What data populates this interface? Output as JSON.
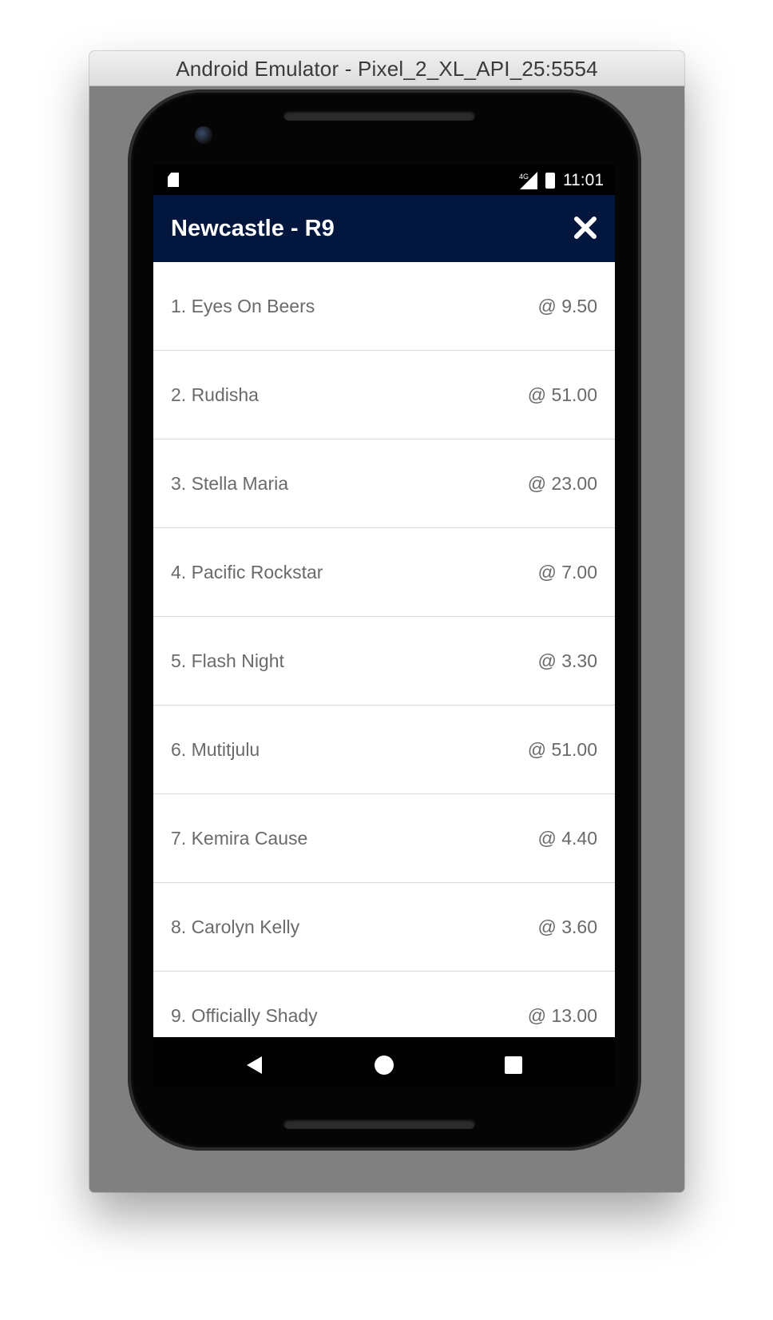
{
  "window": {
    "title": "Android Emulator - Pixel_2_XL_API_25:5554"
  },
  "statusbar": {
    "network": "4G",
    "time": "11:01"
  },
  "appbar": {
    "title": "Newcastle - R9",
    "close_icon": "close-icon"
  },
  "runners": [
    {
      "name": "1. Eyes On Beers",
      "odds": "@ 9.50"
    },
    {
      "name": "2. Rudisha",
      "odds": "@ 51.00"
    },
    {
      "name": "3. Stella Maria",
      "odds": "@ 23.00"
    },
    {
      "name": "4. Pacific Rockstar",
      "odds": "@ 7.00"
    },
    {
      "name": "5. Flash Night",
      "odds": "@ 3.30"
    },
    {
      "name": "6. Mutitjulu",
      "odds": "@ 51.00"
    },
    {
      "name": "7. Kemira Cause",
      "odds": "@ 4.40"
    },
    {
      "name": "8. Carolyn Kelly",
      "odds": "@ 3.60"
    },
    {
      "name": "9. Officially Shady",
      "odds": "@ 13.00"
    }
  ],
  "navbar": {
    "back_icon": "back-triangle-icon",
    "home_icon": "home-circle-icon",
    "recents_icon": "recents-square-icon"
  },
  "colors": {
    "appbar": "#03163d",
    "list_text": "#6a6a6a",
    "emulator_bg": "#808080"
  }
}
